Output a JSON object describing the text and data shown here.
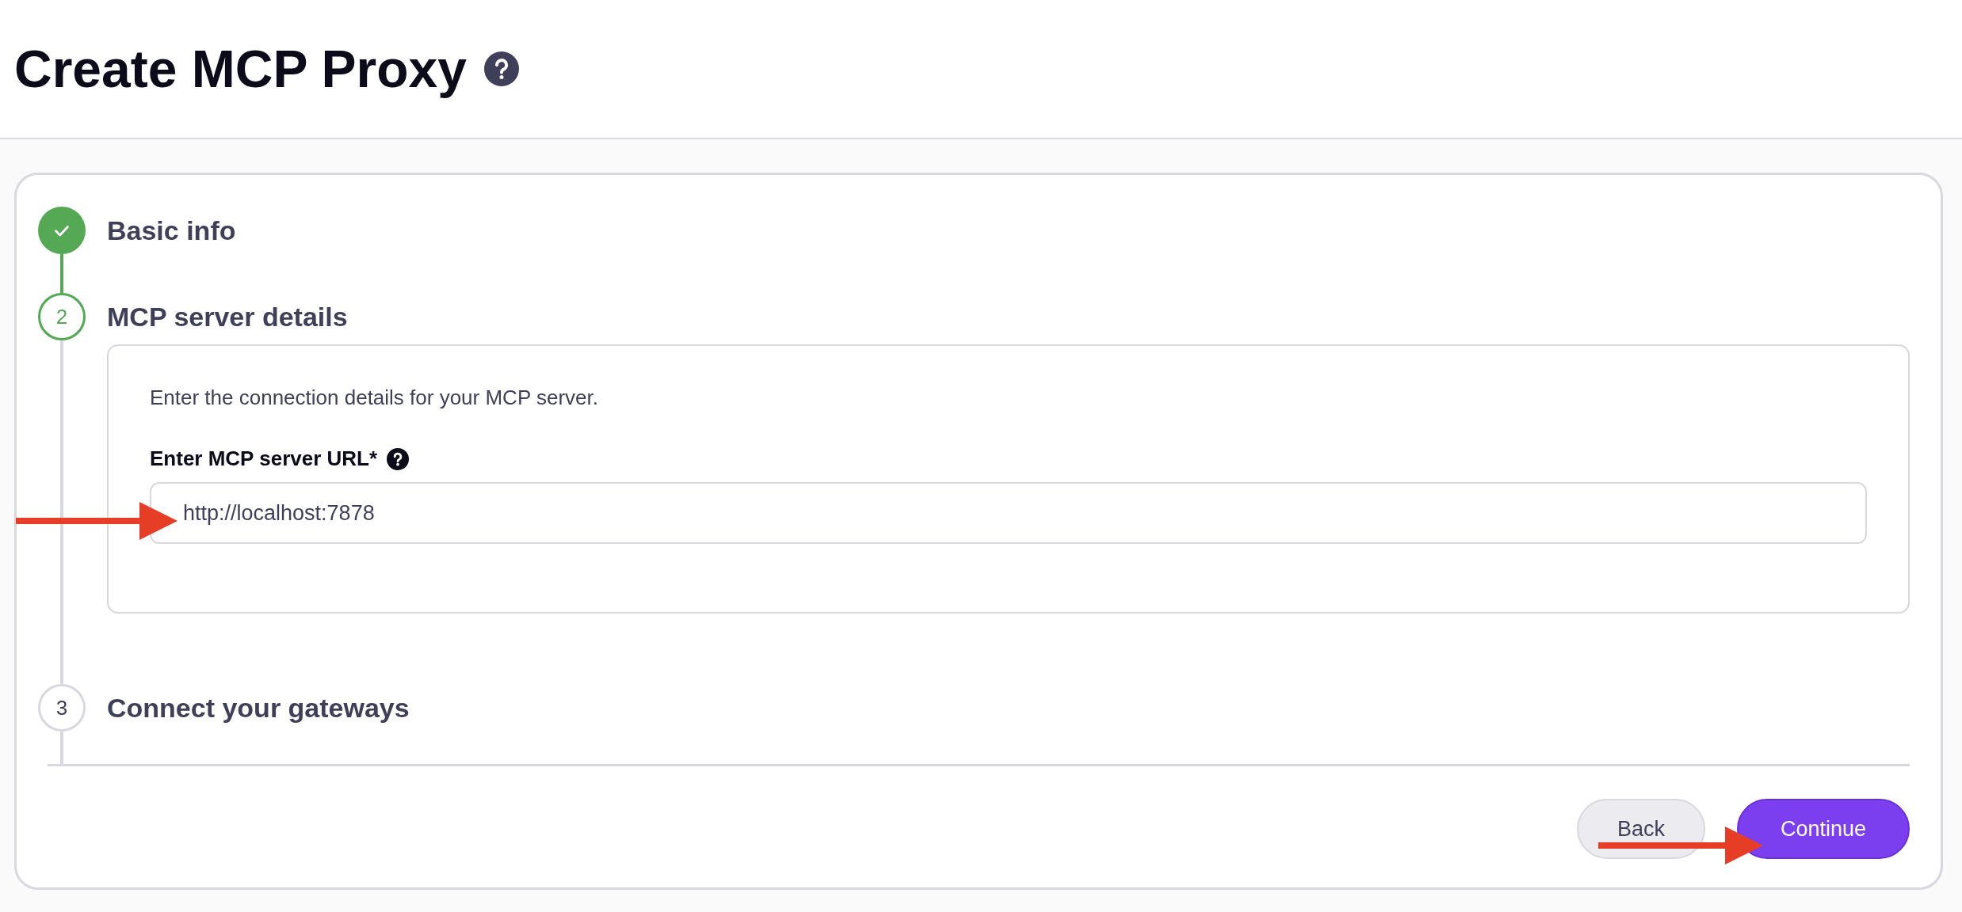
{
  "page": {
    "title": "Create MCP Proxy"
  },
  "steps": [
    {
      "title": "Basic info",
      "completed": true,
      "active": false
    },
    {
      "number": "2",
      "title": "MCP server details",
      "completed": false,
      "active": true,
      "description": "Enter the connection details for your MCP server.",
      "field": {
        "label": "Enter MCP server URL*",
        "value": "http://localhost:7878"
      }
    },
    {
      "number": "3",
      "title": "Connect your gateways",
      "completed": false,
      "active": false
    }
  ],
  "buttons": [
    {
      "label": "Back",
      "kind": "secondary"
    },
    {
      "label": "Continue",
      "kind": "primary"
    }
  ]
}
